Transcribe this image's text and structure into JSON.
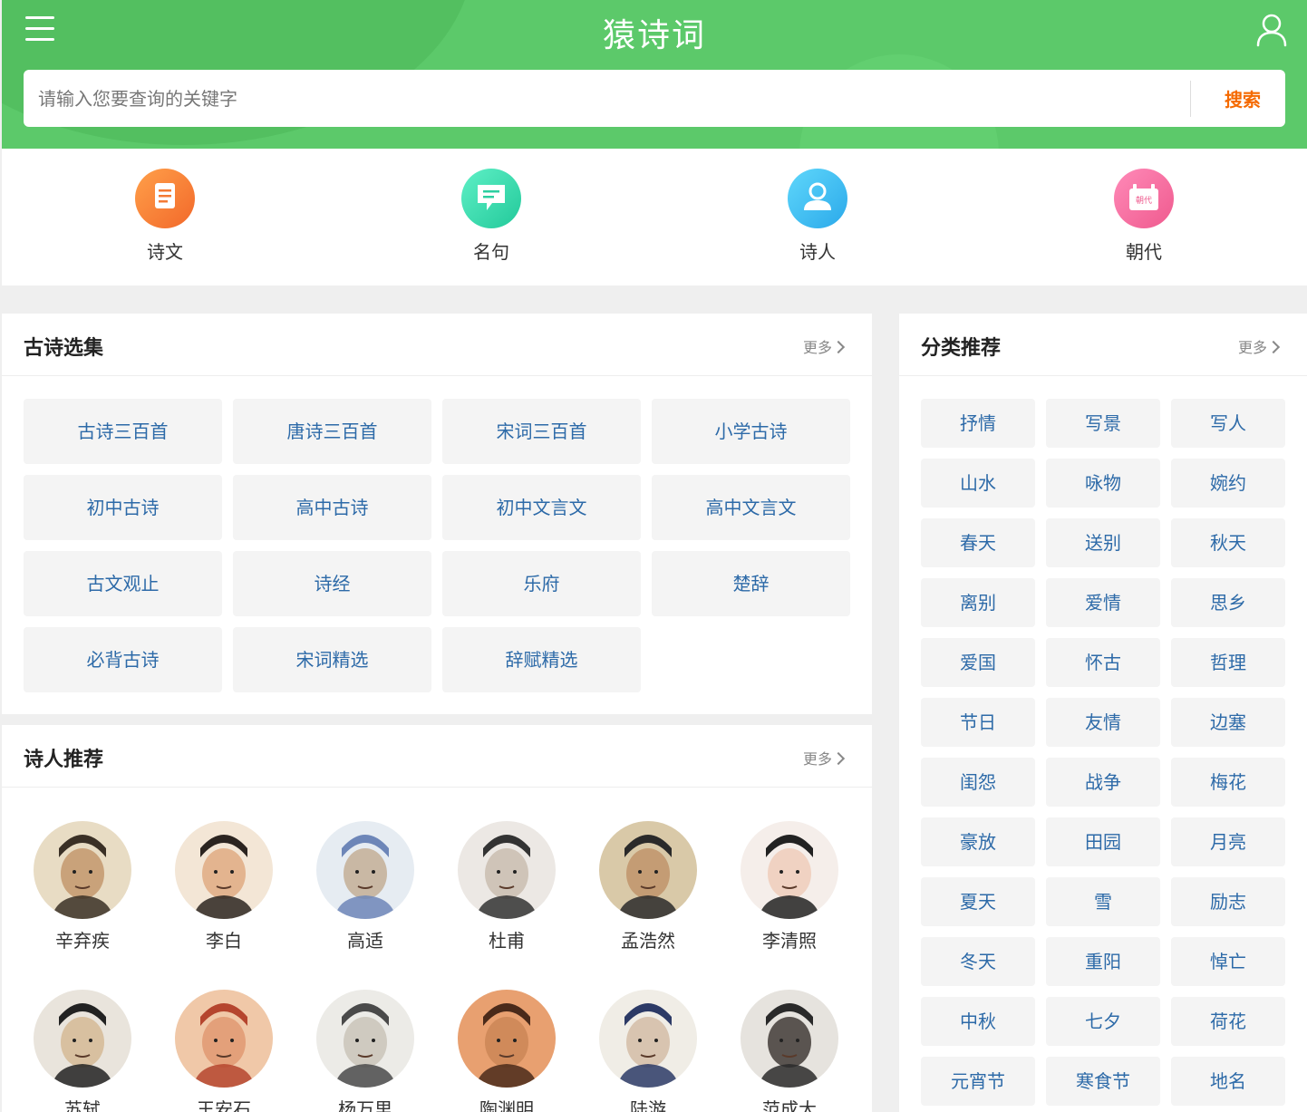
{
  "header": {
    "logo": "猿诗词",
    "search_placeholder": "请输入您要查询的关键字",
    "search_label": "搜索"
  },
  "quick_nav": [
    {
      "label": "诗文",
      "icon": "document-icon"
    },
    {
      "label": "名句",
      "icon": "chat-quote-icon"
    },
    {
      "label": "诗人",
      "icon": "poet-person-icon"
    },
    {
      "label": "朝代",
      "icon": "dynasty-calendar-icon",
      "badge": "朝代"
    }
  ],
  "collections": {
    "title": "古诗选集",
    "more": "更多",
    "items": [
      "古诗三百首",
      "唐诗三百首",
      "宋词三百首",
      "小学古诗",
      "初中古诗",
      "高中古诗",
      "初中文言文",
      "高中文言文",
      "古文观止",
      "诗经",
      "乐府",
      "楚辞",
      "必背古诗",
      "宋词精选",
      "辞赋精选"
    ]
  },
  "poets": {
    "title": "诗人推荐",
    "more": "更多",
    "items": [
      "辛弃疾",
      "李白",
      "高适",
      "杜甫",
      "孟浩然",
      "李清照",
      "苏轼",
      "王安石",
      "杨万里",
      "陶渊明",
      "陆游",
      "范成大"
    ]
  },
  "categories": {
    "title": "分类推荐",
    "more": "更多",
    "items": [
      "抒情",
      "写景",
      "写人",
      "山水",
      "咏物",
      "婉约",
      "春天",
      "送别",
      "秋天",
      "离别",
      "爱情",
      "思乡",
      "爱国",
      "怀古",
      "哲理",
      "节日",
      "友情",
      "边塞",
      "闺怨",
      "战争",
      "梅花",
      "豪放",
      "田园",
      "月亮",
      "夏天",
      "雪",
      "励志",
      "冬天",
      "重阳",
      "悼亡",
      "中秋",
      "七夕",
      "荷花",
      "元宵节",
      "寒食节",
      "地名"
    ]
  },
  "colors": {
    "header_green": "#5cc96a",
    "search_accent": "#f56a00",
    "tag_text": "#2d6aa8"
  }
}
